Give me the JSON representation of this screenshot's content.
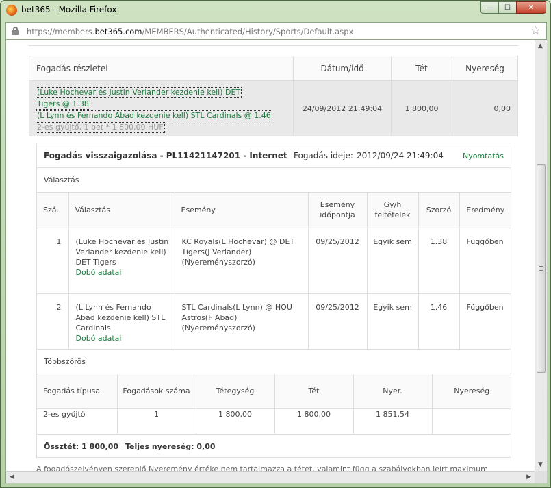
{
  "window": {
    "title": "bet365 - Mozilla Firefox",
    "min": "—",
    "max": "☐",
    "close": "✕"
  },
  "address": {
    "prefix": "https://members.",
    "domain": "bet365.com",
    "path": "/MEMBERS/Authenticated/History/Sports/Default.aspx"
  },
  "summary": {
    "headers": {
      "details": "Fogadás részletei",
      "date": "Dátum/idő",
      "stake": "Tét",
      "winnings": "Nyereség"
    },
    "selections": [
      "(Luke Hochevar és Justin Verlander kezdenie kell) DET",
      "Tigers @ 1.38",
      "(L Lynn és Fernando Abad kezdenie kell) STL Cardinals @ 1.46",
      "2-es gyűjtő, 1 bet * 1 800,00 HUF"
    ],
    "date": "24/09/2012 21:49:04",
    "stake": "1 800,00",
    "winnings": "0,00"
  },
  "confirmation": {
    "title": "Fogadás visszaigazolása  - PL11421147201  - Internet",
    "time_label": "Fogadás ideje:",
    "time": "2012/09/24 21:49:04",
    "print": "Nyomtatás",
    "selection_section": "Választás",
    "columns": {
      "no": "Szá.",
      "selection": "Választás",
      "event": "Esemény",
      "event_time": "Esemény időpontja",
      "conditions": "Gy/h feltételek",
      "odds": "Szorzó",
      "result": "Eredmény"
    },
    "rows": [
      {
        "no": "1",
        "selection": "(Luke Hochevar és Justin Verlander kezdenie kell) DET Tigers",
        "pitcher_link": "Dobó adatai",
        "event": "KC Royals(L Hochevar) @ DET Tigers(J Verlander) (Nyereményszorzó)",
        "event_time": "09/25/2012",
        "conditions": "Egyik sem",
        "odds": "1.38",
        "result": "Függőben"
      },
      {
        "no": "2",
        "selection": "(L Lynn és Fernando Abad kezdenie kell) STL Cardinals",
        "pitcher_link": "Dobó adatai",
        "event": "STL Cardinals(L Lynn) @ HOU Astros(F Abad) (Nyereményszorzó)",
        "event_time": "09/25/2012",
        "conditions": "Egyik sem",
        "odds": "1.46",
        "result": "Függőben"
      }
    ],
    "multiples_section": "Többszörös",
    "multi_columns": {
      "type": "Fogadás típusa",
      "count": "Fogadások száma",
      "unit": "Tétegység",
      "stake": "Tét",
      "return": "Nyer.",
      "winnings": "Nyereség"
    },
    "multi_row": {
      "type": "2-es gyűjtő",
      "count": "1",
      "unit": "1 800,00",
      "stake": "1 800,00",
      "return": "1 851,54",
      "winnings": ""
    },
    "totals": {
      "stake_label": "Össztét:",
      "stake": "1 800,00",
      "winnings_label": "Teljes nyereség:",
      "winnings": "0,00"
    }
  },
  "footnote": "A fogadószelvényen szereplő Nyeremény értéke nem tartalmazza a tétet, valamint függ a szabályokban leírt maximum"
}
